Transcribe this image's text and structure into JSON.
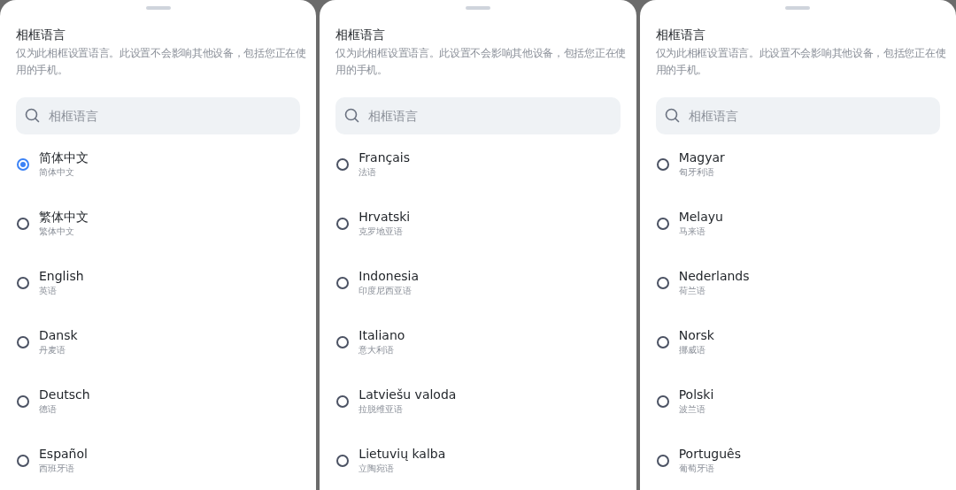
{
  "panels": [
    {
      "title": "相框语言",
      "description": "仅为此相框设置语言。此设置不会影响其他设备，包括您正在使用的手机。",
      "search": {
        "placeholder": "相框语言"
      },
      "languages": [
        {
          "name": "简体中文",
          "subtitle": "简体中文",
          "selected": true
        },
        {
          "name": "繁体中文",
          "subtitle": "繁体中文",
          "selected": false
        },
        {
          "name": "English",
          "subtitle": "英语",
          "selected": false
        },
        {
          "name": "Dansk",
          "subtitle": "丹麦语",
          "selected": false
        },
        {
          "name": "Deutsch",
          "subtitle": "德语",
          "selected": false
        },
        {
          "name": "Español",
          "subtitle": "西班牙语",
          "selected": false
        }
      ]
    },
    {
      "title": "相框语言",
      "description": "仅为此相框设置语言。此设置不会影响其他设备，包括您正在使用的手机。",
      "search": {
        "placeholder": "相框语言"
      },
      "languages": [
        {
          "name": "Français",
          "subtitle": "法语",
          "selected": false
        },
        {
          "name": "Hrvatski",
          "subtitle": "克罗地亚语",
          "selected": false
        },
        {
          "name": "Indonesia",
          "subtitle": "印度尼西亚语",
          "selected": false
        },
        {
          "name": "Italiano",
          "subtitle": "意大利语",
          "selected": false
        },
        {
          "name": "Latviešu valoda",
          "subtitle": "拉脱维亚语",
          "selected": false
        },
        {
          "name": "Lietuvių kalba",
          "subtitle": "立陶宛语",
          "selected": false
        }
      ]
    },
    {
      "title": "相框语言",
      "description": "仅为此相框设置语言。此设置不会影响其他设备，包括您正在使用的手机。",
      "search": {
        "placeholder": "相框语言"
      },
      "languages": [
        {
          "name": "Magyar",
          "subtitle": "匈牙利语",
          "selected": false
        },
        {
          "name": "Melayu",
          "subtitle": "马来语",
          "selected": false
        },
        {
          "name": "Nederlands",
          "subtitle": "荷兰语",
          "selected": false
        },
        {
          "name": "Norsk",
          "subtitle": "挪威语",
          "selected": false
        },
        {
          "name": "Polski",
          "subtitle": "波兰语",
          "selected": false
        },
        {
          "name": "Português",
          "subtitle": "葡萄牙语",
          "selected": false
        }
      ]
    }
  ]
}
